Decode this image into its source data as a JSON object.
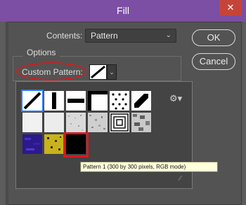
{
  "window": {
    "title": "Fill",
    "close_symbol": "✕"
  },
  "contents": {
    "label": "Contents:",
    "selected": "Pattern",
    "chevron": "⌄"
  },
  "buttons": {
    "ok": "OK",
    "cancel": "Cancel"
  },
  "options": {
    "legend": "Options",
    "custom_pattern_label": "Custom Pattern:",
    "dropdown_chevron": "⌄"
  },
  "picker": {
    "menu_icon": "⚙▾",
    "grip": "⁄⁄",
    "patterns": [
      "diagonal-line-white",
      "vertical-bar",
      "horizontal-bar",
      "corner-square",
      "dots-white",
      "diagonal-black",
      "cloud-white-1",
      "cloud-white-2",
      "noise-grey",
      "granite-grey",
      "concentric-squares",
      "stone-grey",
      "blue-purple",
      "yellow-speckle",
      "black-solid"
    ],
    "selected_tile": "diagonal-line-white",
    "highlighted_tile": "black-solid",
    "tooltip": "Pattern 1 (300 by 300 pixels, RGB mode)"
  },
  "colors": {
    "titlebar": "#7c4ea4",
    "highlight_red": "#d31c22",
    "selection_blue": "#2a7ef0"
  }
}
